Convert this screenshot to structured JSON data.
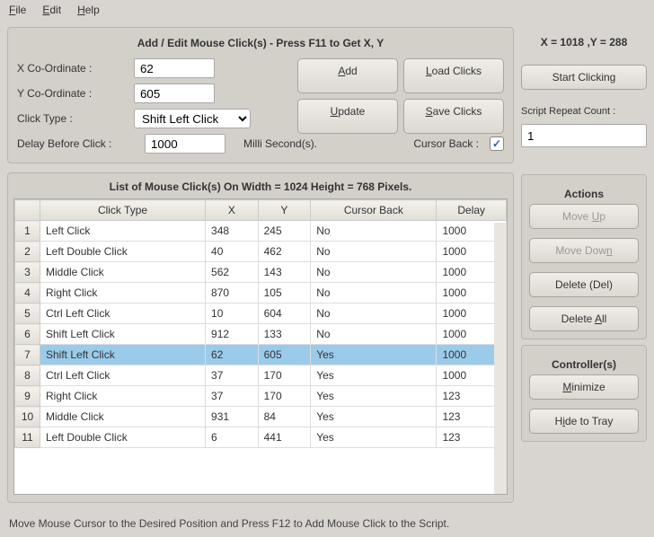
{
  "menu": {
    "file": "File",
    "edit": "Edit",
    "help": "Help"
  },
  "addEdit": {
    "title": "Add / Edit Mouse Click(s) - Press F11 to Get X, Y",
    "xLabel": "X Co-Ordinate :",
    "yLabel": "Y Co-Ordinate :",
    "clickTypeLabel": "Click Type :",
    "delayLabel": "Delay Before Click :",
    "xValue": "62",
    "yValue": "605",
    "clickTypeValue": "Shift Left Click",
    "delayValue": "1000",
    "msLabel": "Milli Second(s).",
    "cursorBackLabel": "Cursor Back :",
    "cursorBackChecked": "✓",
    "addBtn": "Add",
    "loadBtn": "Load Clicks",
    "updateBtn": "Update",
    "saveBtn": "Save Clicks"
  },
  "status": {
    "xy": "X = 1018 ,Y = 288"
  },
  "startBtn": "Start Clicking",
  "repeat": {
    "label": "Script Repeat Count :",
    "value": "1"
  },
  "list": {
    "title": "List of Mouse Click(s) On Width = 1024 Height = 768 Pixels.",
    "headers": {
      "type": "Click Type",
      "x": "X",
      "y": "Y",
      "cb": "Cursor Back",
      "delay": "Delay"
    },
    "rows": [
      {
        "n": "1",
        "type": "Left Click",
        "x": "348",
        "y": "245",
        "cb": "No",
        "delay": "1000",
        "sel": false
      },
      {
        "n": "2",
        "type": "Left Double Click",
        "x": "40",
        "y": "462",
        "cb": "No",
        "delay": "1000",
        "sel": false
      },
      {
        "n": "3",
        "type": "Middle Click",
        "x": "562",
        "y": "143",
        "cb": "No",
        "delay": "1000",
        "sel": false
      },
      {
        "n": "4",
        "type": "Right Click",
        "x": "870",
        "y": "105",
        "cb": "No",
        "delay": "1000",
        "sel": false
      },
      {
        "n": "5",
        "type": "Ctrl Left Click",
        "x": "10",
        "y": "604",
        "cb": "No",
        "delay": "1000",
        "sel": false
      },
      {
        "n": "6",
        "type": "Shift Left Click",
        "x": "912",
        "y": "133",
        "cb": "No",
        "delay": "1000",
        "sel": false
      },
      {
        "n": "7",
        "type": "Shift Left Click",
        "x": "62",
        "y": "605",
        "cb": "Yes",
        "delay": "1000",
        "sel": true
      },
      {
        "n": "8",
        "type": "Ctrl Left Click",
        "x": "37",
        "y": "170",
        "cb": "Yes",
        "delay": "1000",
        "sel": false
      },
      {
        "n": "9",
        "type": "Right Click",
        "x": "37",
        "y": "170",
        "cb": "Yes",
        "delay": "123",
        "sel": false
      },
      {
        "n": "10",
        "type": "Middle Click",
        "x": "931",
        "y": "84",
        "cb": "Yes",
        "delay": "123",
        "sel": false
      },
      {
        "n": "11",
        "type": "Left Double Click",
        "x": "6",
        "y": "441",
        "cb": "Yes",
        "delay": "123",
        "sel": false
      }
    ]
  },
  "actions": {
    "label": "Actions",
    "moveUp": "Move Up",
    "moveDown": "Move Down",
    "delete": "Delete (Del)",
    "deleteAll": "Delete All"
  },
  "controllers": {
    "label": "Controller(s)",
    "minimize": "Minimize",
    "hide": "Hide to Tray"
  },
  "footer": "Move Mouse Cursor to the Desired Position and Press F12 to Add Mouse Click to the Script."
}
